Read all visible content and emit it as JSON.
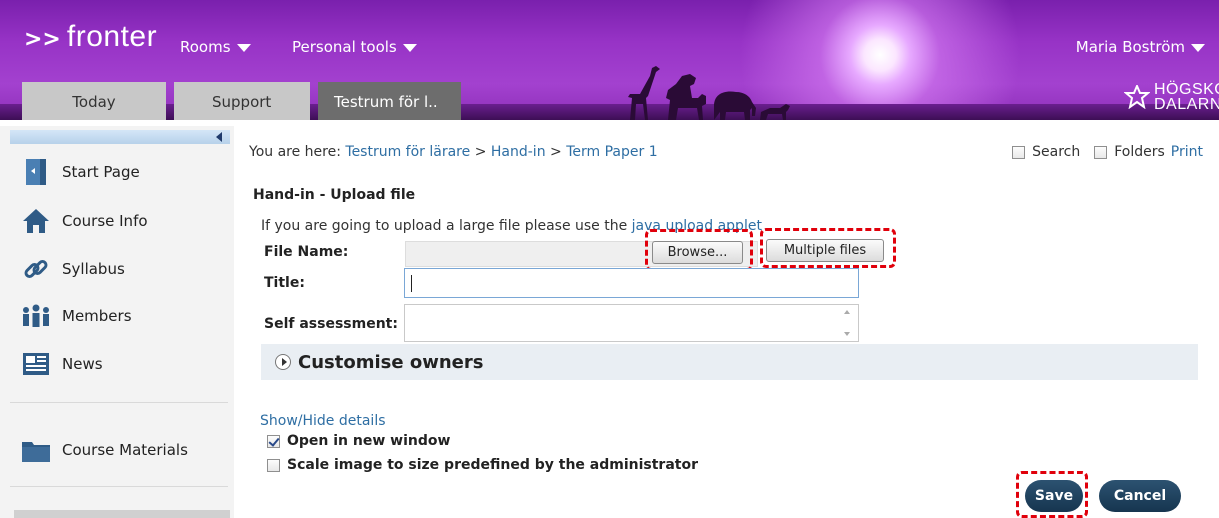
{
  "header": {
    "logo": {
      "arrows": ">>",
      "text": "fronter"
    },
    "nav": [
      {
        "label": "Rooms"
      },
      {
        "label": "Personal tools"
      }
    ],
    "user_name": "Maria Boström",
    "tabs": [
      {
        "label": "Today"
      },
      {
        "label": "Support"
      },
      {
        "label": "Testrum för l.."
      }
    ],
    "brand": {
      "line1": "HÖGSKOLAN",
      "line2": "DALARNA"
    }
  },
  "sidebar": {
    "items": [
      {
        "label": "Start Page",
        "icon": "door-icon"
      },
      {
        "label": "Course Info",
        "icon": "home-icon"
      },
      {
        "label": "Syllabus",
        "icon": "link-icon"
      },
      {
        "label": "Members",
        "icon": "people-icon"
      },
      {
        "label": "News",
        "icon": "newspaper-icon"
      },
      {
        "label": "Course Materials",
        "icon": "folder-icon"
      }
    ]
  },
  "breadcrumb": {
    "prefix": "You are here:",
    "items": [
      "Testrum för lärare",
      "Hand-in",
      "Term Paper 1"
    ],
    "separator": ">"
  },
  "top_options": {
    "search": "Search",
    "folders": "Folders",
    "print": "Print"
  },
  "form": {
    "section_title": "Hand-in - Upload file",
    "note_prefix": "If you are going to upload a large file please use the ",
    "note_link": "java upload applet",
    "file_name_label": "File Name:",
    "browse_label": "Browse...",
    "multiple_files_label": "Multiple files",
    "title_label": "Title:",
    "title_value": "",
    "self_assessment_label": "Self assessment:",
    "self_assessment_value": "",
    "customise_owners": "Customise owners",
    "show_hide": "Show/Hide details",
    "open_new_window": {
      "label": "Open in new window",
      "checked": true
    },
    "scale_image": {
      "label": "Scale image to size predefined by the administrator",
      "checked": false
    },
    "save_label": "Save",
    "cancel_label": "Cancel"
  },
  "colors": {
    "header_purple": "#9733c6",
    "link_blue": "#2e6ea3",
    "button_dark": "#1f4461",
    "highlight_red": "#e0000b"
  }
}
